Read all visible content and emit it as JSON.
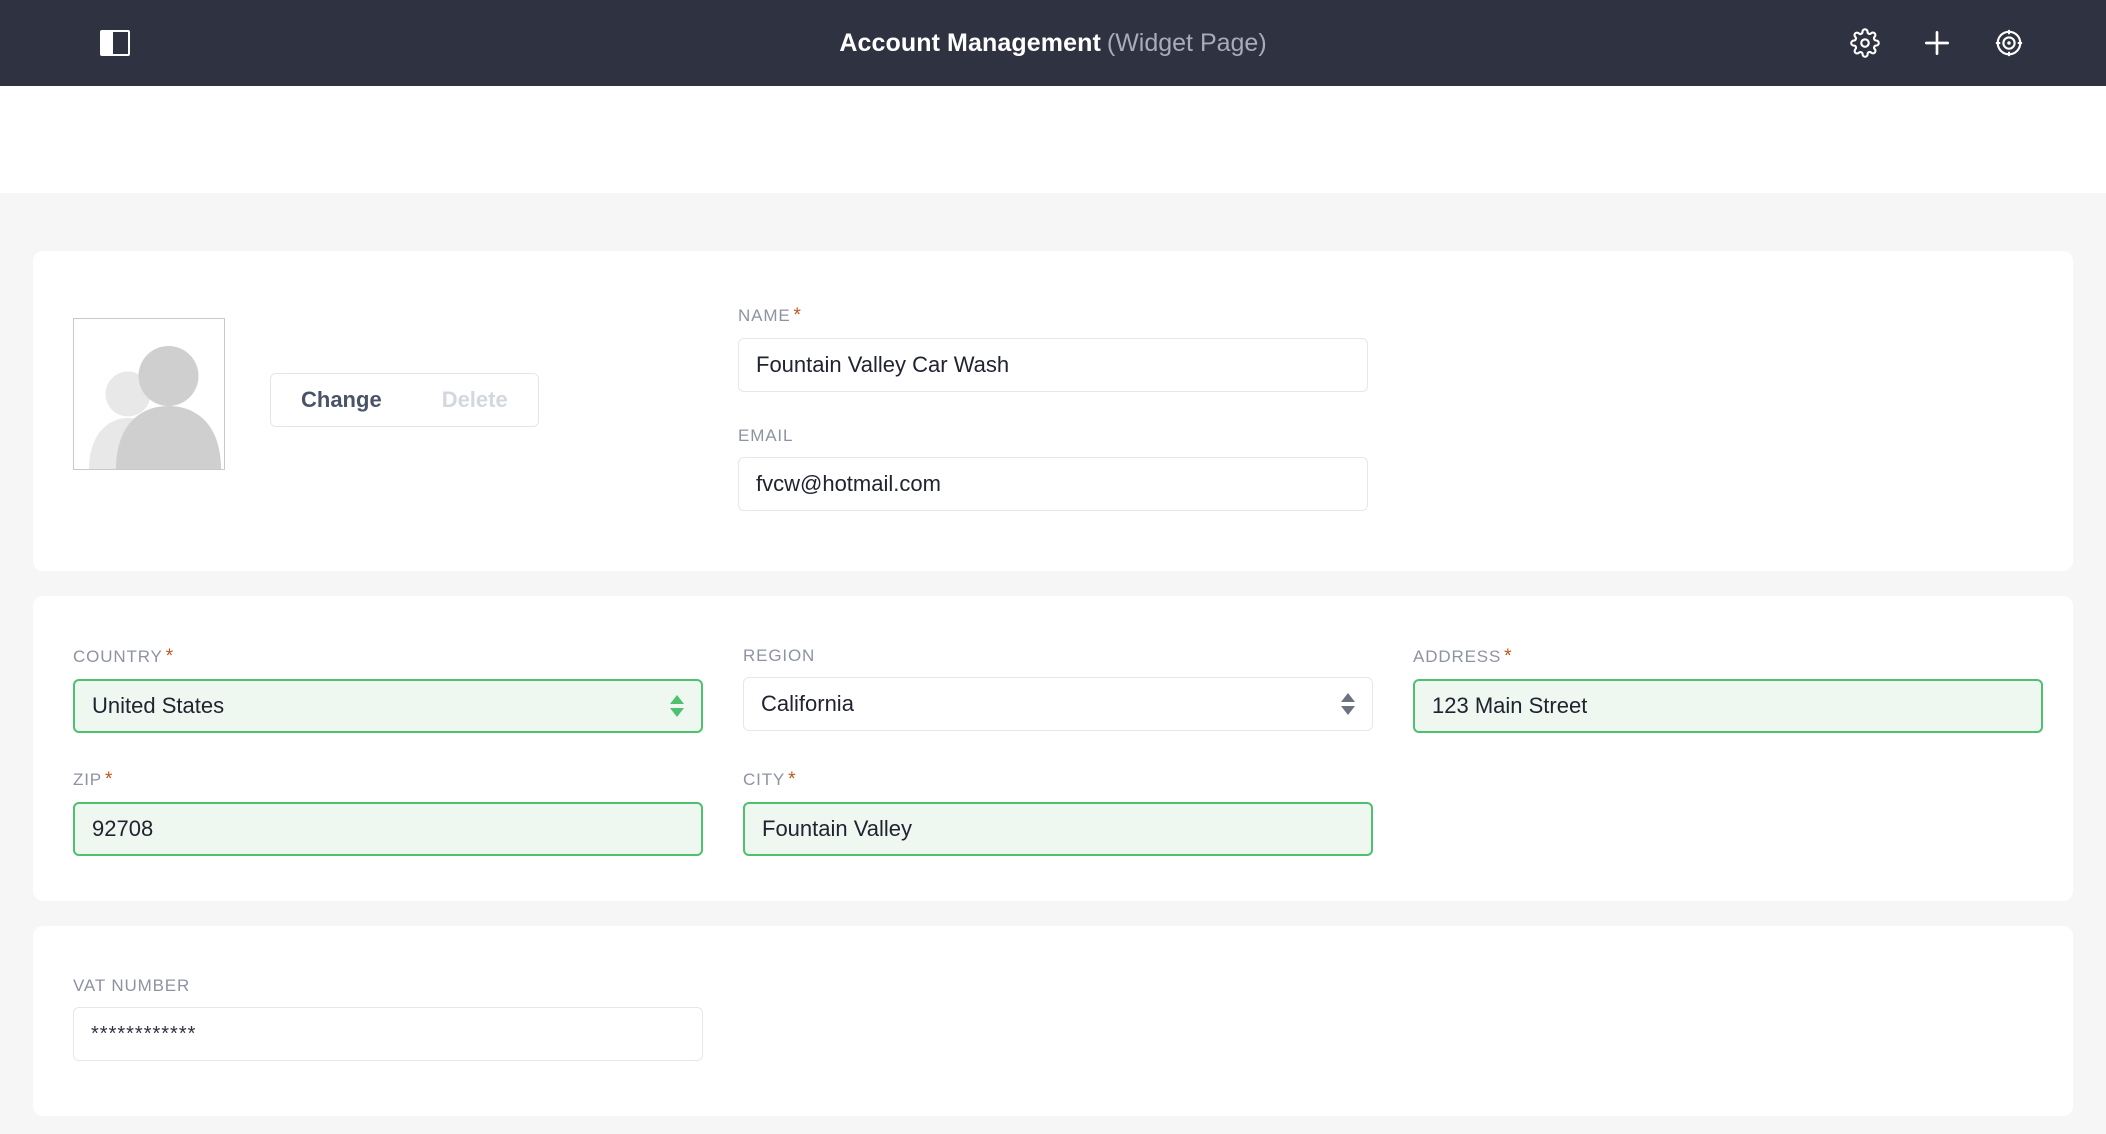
{
  "topbar": {
    "menu_icon": "sidebar-toggle-icon",
    "title_main": "Account Management",
    "title_sub": "(Widget Page)",
    "actions": [
      {
        "name": "settings-icon",
        "label": "Settings"
      },
      {
        "name": "plus-icon",
        "label": "Add"
      },
      {
        "name": "target-icon",
        "label": "Target"
      }
    ],
    "bg_color": "#2f3240",
    "title_color": "#ffffff",
    "subtitle_color": "#a7abba"
  },
  "profile": {
    "avatar_alt": "user-placeholder-avatar",
    "change_label": "Change",
    "delete_label": "Delete",
    "name": {
      "label": "NAME",
      "required": true,
      "value": "Fountain Valley Car Wash",
      "placeholder": ""
    },
    "email": {
      "label": "EMAIL",
      "required": false,
      "value": "fvcw@hotmail.com",
      "placeholder": ""
    }
  },
  "address": {
    "country": {
      "label": "COUNTRY",
      "required": true,
      "value": "United States",
      "valid": true
    },
    "region": {
      "label": "REGION",
      "required": false,
      "value": "California",
      "valid": false
    },
    "street": {
      "label": "ADDRESS",
      "required": true,
      "value": "123 Main Street",
      "valid": true
    },
    "zip": {
      "label": "ZIP",
      "required": true,
      "value": "92708",
      "valid": true
    },
    "city": {
      "label": "CITY",
      "required": true,
      "value": "Fountain Valley",
      "valid": true
    }
  },
  "vat": {
    "label": "VAT NUMBER",
    "required": false,
    "value": "************"
  },
  "colors": {
    "page_background": "#f6f6f7",
    "card_background": "#ffffff",
    "valid_border": "#4ec06e",
    "valid_fill": "#eef8f0",
    "required_marker": "#c0561b",
    "label_text": "#8d93a1"
  }
}
